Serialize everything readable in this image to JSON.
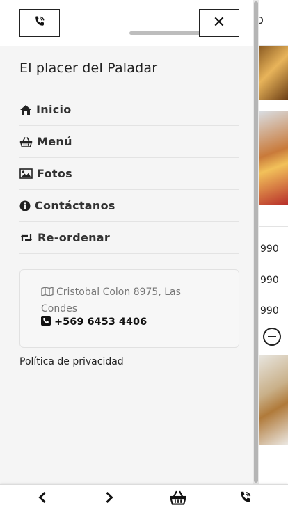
{
  "background": {
    "header_partial": "o",
    "prices": [
      "990",
      "990",
      "990"
    ]
  },
  "drawer": {
    "title": "El placer del Paladar",
    "header": {
      "call_icon": "phone-volume-icon",
      "close_icon": "close-icon",
      "close_glyph": "✕"
    },
    "menu": [
      {
        "label": "Inicio",
        "icon": "home-icon"
      },
      {
        "label": "Menú",
        "icon": "basket-icon"
      },
      {
        "label": "Fotos",
        "icon": "image-icon"
      },
      {
        "label": "Contáctanos",
        "icon": "info-circle-icon"
      },
      {
        "label": "Re-ordenar",
        "icon": "retweet-icon"
      }
    ],
    "contact": {
      "address": "Cristobal Colon 8975, Las Condes",
      "phone": "+569 6453 4406"
    },
    "privacy_label": "Política de privacidad"
  },
  "bottom_bar": {
    "items": [
      "chevron-left-icon",
      "chevron-right-icon",
      "basket-icon",
      "phone-volume-icon"
    ]
  },
  "colors": {
    "drawer_bg": "#f5f5f5",
    "text": "#222222",
    "muted": "#777777",
    "accent_dark": "#111111"
  }
}
